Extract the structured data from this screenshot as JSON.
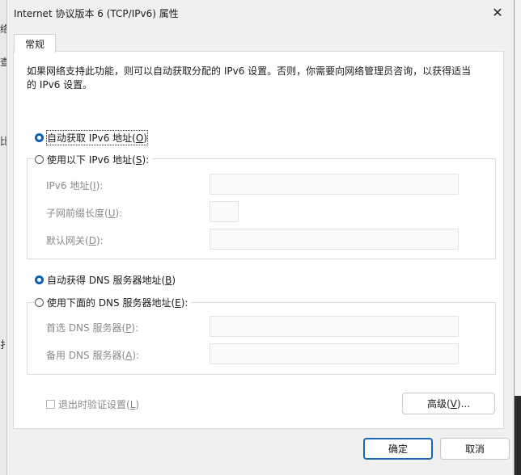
{
  "background": {
    "chars": [
      "络",
      "查",
      "比",
      "扌"
    ]
  },
  "window": {
    "title": "Internet 协议版本 6 (TCP/IPv6) 属性",
    "close_symbol": "✕"
  },
  "tabs": [
    {
      "label": "常规"
    }
  ],
  "description": "如果网络支持此功能，则可以自动获取分配的 IPv6 设置。否则，你需要向网络管理员咨询，以获得适当的 IPv6 设置。",
  "ip_section": {
    "auto": {
      "pre": "自动获取 IPv6 地址(",
      "key": "O",
      "post": ")",
      "selected": true
    },
    "manual": {
      "pre": "使用以下 IPv6 地址(",
      "key": "S",
      "post": "):",
      "selected": false
    },
    "fields": [
      {
        "pre": "IPv6 地址(",
        "key": "I",
        "post": "):",
        "value": ""
      },
      {
        "pre": "子网前缀长度(",
        "key": "U",
        "post": "):",
        "value": ""
      },
      {
        "pre": "默认网关(",
        "key": "D",
        "post": "):",
        "value": ""
      }
    ]
  },
  "dns_section": {
    "auto": {
      "pre": "自动获得 DNS 服务器地址(",
      "key": "B",
      "post": ")",
      "selected": true
    },
    "manual": {
      "pre": "使用下面的 DNS 服务器地址(",
      "key": "E",
      "post": "):",
      "selected": false
    },
    "fields": [
      {
        "pre": "首选 DNS 服务器(",
        "key": "P",
        "post": "):",
        "value": ""
      },
      {
        "pre": "备用 DNS 服务器(",
        "key": "A",
        "post": "):",
        "value": ""
      }
    ]
  },
  "validate_checkbox": {
    "pre": "退出时验证设置(",
    "key": "L",
    "post": ")",
    "checked": false
  },
  "advanced_button": {
    "pre": "高级(",
    "key": "V",
    "post": ")..."
  },
  "ok_button": "确定",
  "cancel_button": "取消",
  "colors": {
    "accent": "#0a5fb4",
    "disabled_text": "#8a8a8a"
  }
}
